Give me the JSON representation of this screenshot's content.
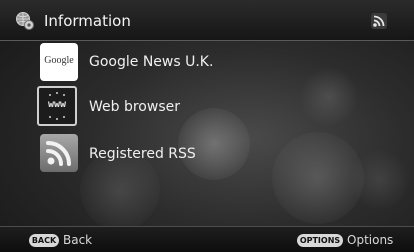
{
  "header": {
    "title": "Information",
    "icon": "globe-gear-icon",
    "indicator_icon": "rss-signal-icon"
  },
  "items": [
    {
      "label": "Google News U.K.",
      "thumb_text": "Google",
      "icon": "google-news-thumbnail"
    },
    {
      "label": "Web browser",
      "thumb_text": "www",
      "icon": "web-browser-icon"
    },
    {
      "label": "Registered RSS",
      "icon": "rss-feed-icon"
    }
  ],
  "footer": {
    "back_key": "BACK",
    "back_label": "Back",
    "options_key": "OPTIONS",
    "options_label": "Options"
  },
  "colors": {
    "selection_border": "#cfcfcf",
    "rss_orange": "#8a8a8a"
  }
}
